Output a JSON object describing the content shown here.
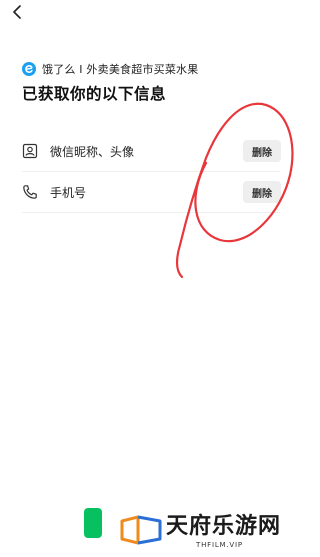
{
  "nav": {
    "back_icon": "chevron-left-icon"
  },
  "app": {
    "logo_icon": "eleme-logo-icon",
    "logo_color": "#1aa0f0",
    "name": "饿了么 I 外卖美食超市买菜水果"
  },
  "title": "已获取你的以下信息",
  "permissions": [
    {
      "icon": "id-card-icon",
      "label": "微信昵称、头像",
      "action": "删除"
    },
    {
      "icon": "phone-icon",
      "label": "手机号",
      "action": "删除"
    }
  ],
  "annotation": {
    "color": "#e8363a"
  },
  "watermark": {
    "title": "天府乐游网",
    "subtitle": "THFILM.VIP",
    "accent_orange": "#f08a1c",
    "accent_blue": "#2a6fd6"
  },
  "bottom": {
    "green_button_color": "#07c160"
  }
}
